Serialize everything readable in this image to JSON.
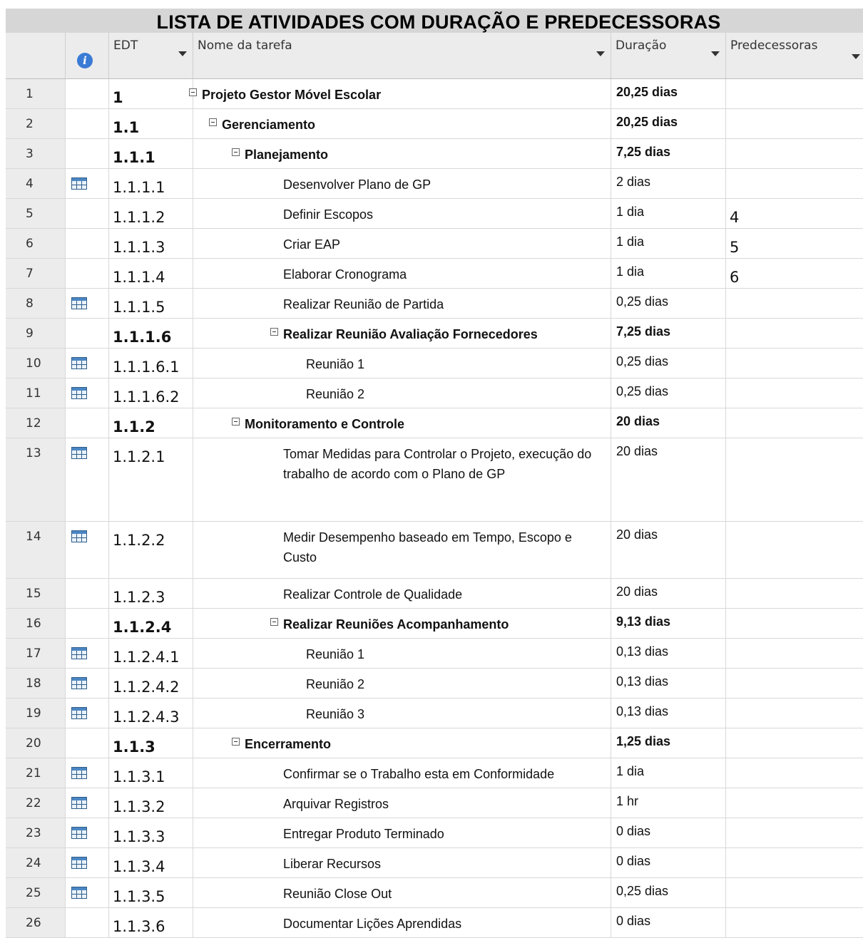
{
  "title": "LISTA DE ATIVIDADES COM DURAÇÃO E PREDECESSORAS",
  "columns": {
    "indicator_icon": "info-icon",
    "edt": "EDT",
    "name": "Nome da tarefa",
    "duration": "Duração",
    "predecessors": "Predecessoras"
  },
  "rows": [
    {
      "id": "1",
      "edt": "1",
      "name": "Projeto Gestor Móvel Escolar",
      "duration": "20,25 dias",
      "pred": "",
      "level": 0,
      "summary": true,
      "icon": ""
    },
    {
      "id": "2",
      "edt": "1.1",
      "name": "Gerenciamento",
      "duration": "20,25 dias",
      "pred": "",
      "level": 1,
      "summary": true,
      "icon": ""
    },
    {
      "id": "3",
      "edt": "1.1.1",
      "name": "Planejamento",
      "duration": "7,25 dias",
      "pred": "",
      "level": 2,
      "summary": true,
      "icon": ""
    },
    {
      "id": "4",
      "edt": "1.1.1.1",
      "name": "Desenvolver Plano de GP",
      "duration": "2 dias",
      "pred": "",
      "level": 3,
      "summary": false,
      "icon": "calendar-icon"
    },
    {
      "id": "5",
      "edt": "1.1.1.2",
      "name": "Definir Escopos",
      "duration": "1 dia",
      "pred": "4",
      "level": 3,
      "summary": false,
      "icon": ""
    },
    {
      "id": "6",
      "edt": "1.1.1.3",
      "name": "Criar EAP",
      "duration": "1 dia",
      "pred": "5",
      "level": 3,
      "summary": false,
      "icon": ""
    },
    {
      "id": "7",
      "edt": "1.1.1.4",
      "name": "Elaborar Cronograma",
      "duration": "1 dia",
      "pred": "6",
      "level": 3,
      "summary": false,
      "icon": ""
    },
    {
      "id": "8",
      "edt": "1.1.1.5",
      "name": "Realizar Reunião de Partida",
      "duration": "0,25 dias",
      "pred": "",
      "level": 3,
      "summary": false,
      "icon": "calendar-icon"
    },
    {
      "id": "9",
      "edt": "1.1.1.6",
      "name": "Realizar Reunião Avaliação Fornecedores",
      "duration": "7,25 dias",
      "pred": "",
      "level": 3,
      "summary": true,
      "icon": ""
    },
    {
      "id": "10",
      "edt": "1.1.1.6.1",
      "name": "Reunião 1",
      "duration": "0,25 dias",
      "pred": "",
      "level": 4,
      "summary": false,
      "icon": "calendar-icon"
    },
    {
      "id": "11",
      "edt": "1.1.1.6.2",
      "name": "Reunião 2",
      "duration": "0,25 dias",
      "pred": "",
      "level": 4,
      "summary": false,
      "icon": "calendar-icon"
    },
    {
      "id": "12",
      "edt": "1.1.2",
      "name": "Monitoramento e Controle",
      "duration": "20 dias",
      "pred": "",
      "level": 2,
      "summary": true,
      "icon": ""
    },
    {
      "id": "13",
      "edt": "1.1.2.1",
      "name": "Tomar Medidas para Controlar o Projeto, execução do trabalho de acordo com o Plano de GP",
      "duration": "20 dias",
      "pred": "",
      "level": 3,
      "summary": false,
      "icon": "calendar-icon"
    },
    {
      "id": "14",
      "edt": "1.1.2.2",
      "name": "Medir Desempenho baseado em Tempo, Escopo e Custo",
      "duration": "20 dias",
      "pred": "",
      "level": 3,
      "summary": false,
      "icon": "calendar-icon"
    },
    {
      "id": "15",
      "edt": "1.1.2.3",
      "name": "Realizar Controle de Qualidade",
      "duration": "20 dias",
      "pred": "",
      "level": 3,
      "summary": false,
      "icon": ""
    },
    {
      "id": "16",
      "edt": "1.1.2.4",
      "name": "Realizar Reuniões Acompanhamento",
      "duration": "9,13 dias",
      "pred": "",
      "level": 3,
      "summary": true,
      "icon": ""
    },
    {
      "id": "17",
      "edt": "1.1.2.4.1",
      "name": "Reunião 1",
      "duration": "0,13 dias",
      "pred": "",
      "level": 4,
      "summary": false,
      "icon": "calendar-icon"
    },
    {
      "id": "18",
      "edt": "1.1.2.4.2",
      "name": "Reunião 2",
      "duration": "0,13 dias",
      "pred": "",
      "level": 4,
      "summary": false,
      "icon": "calendar-icon"
    },
    {
      "id": "19",
      "edt": "1.1.2.4.3",
      "name": "Reunião 3",
      "duration": "0,13 dias",
      "pred": "",
      "level": 4,
      "summary": false,
      "icon": "calendar-icon"
    },
    {
      "id": "20",
      "edt": "1.1.3",
      "name": "Encerramento",
      "duration": "1,25 dias",
      "pred": "",
      "level": 2,
      "summary": true,
      "icon": ""
    },
    {
      "id": "21",
      "edt": "1.1.3.1",
      "name": "Confirmar se o Trabalho esta em Conformidade",
      "duration": "1 dia",
      "pred": "",
      "level": 3,
      "summary": false,
      "icon": "calendar-icon"
    },
    {
      "id": "22",
      "edt": "1.1.3.2",
      "name": "Arquivar Registros",
      "duration": "1 hr",
      "pred": "",
      "level": 3,
      "summary": false,
      "icon": "calendar-icon"
    },
    {
      "id": "23",
      "edt": "1.1.3.3",
      "name": "Entregar Produto Terminado",
      "duration": "0 dias",
      "pred": "",
      "level": 3,
      "summary": false,
      "icon": "calendar-icon"
    },
    {
      "id": "24",
      "edt": "1.1.3.4",
      "name": "Liberar Recursos",
      "duration": "0 dias",
      "pred": "",
      "level": 3,
      "summary": false,
      "icon": "calendar-icon"
    },
    {
      "id": "25",
      "edt": "1.1.3.5",
      "name": "Reunião Close Out",
      "duration": "0,25 dias",
      "pred": "",
      "level": 3,
      "summary": false,
      "icon": "calendar-icon"
    },
    {
      "id": "26",
      "edt": "1.1.3.6",
      "name": "Documentar Lições Aprendidas",
      "duration": "0 dias",
      "pred": "",
      "level": 3,
      "summary": false,
      "icon": ""
    }
  ]
}
